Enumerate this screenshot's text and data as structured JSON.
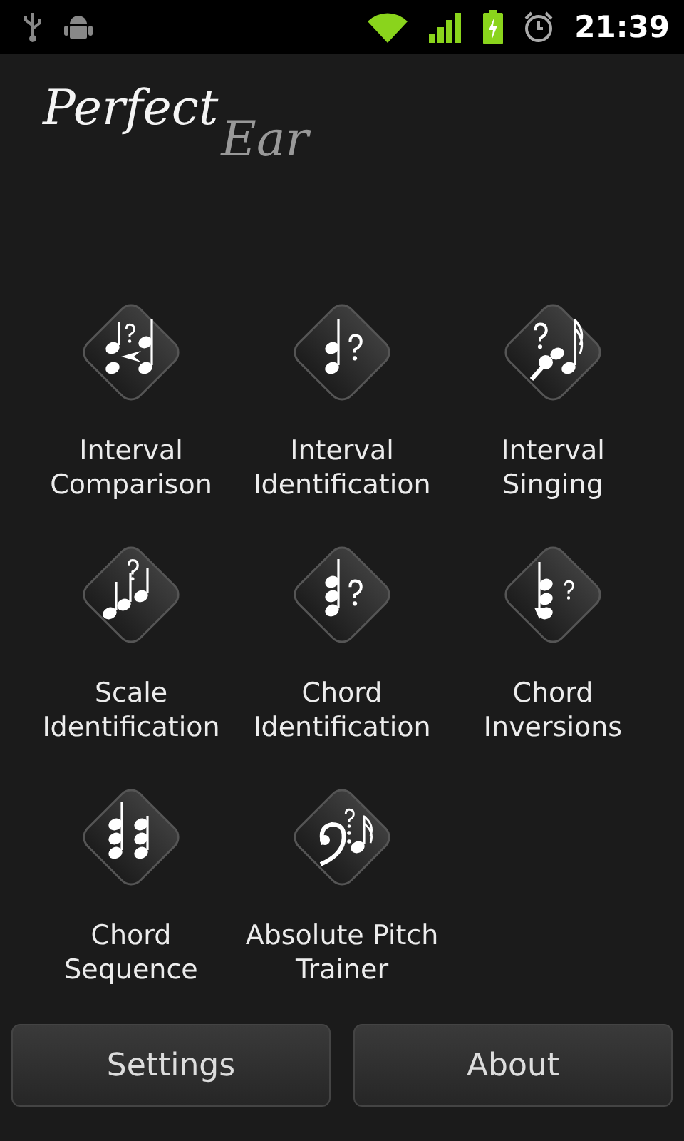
{
  "status_bar": {
    "time": "21:39"
  },
  "logo": {
    "first": "Perfect",
    "second": "Ear"
  },
  "exercises": [
    {
      "label": "Interval Comparison",
      "kind": "comparison"
    },
    {
      "label": "Interval Identification",
      "kind": "interval"
    },
    {
      "label": "Interval Singing",
      "kind": "singing"
    },
    {
      "label": "Scale Identification",
      "kind": "scale"
    },
    {
      "label": "Chord Identification",
      "kind": "chord"
    },
    {
      "label": "Chord Inversions",
      "kind": "inversion"
    },
    {
      "label": "Chord Sequence",
      "kind": "sequence"
    },
    {
      "label": "Absolute Pitch Trainer",
      "kind": "pitch"
    }
  ],
  "buttons": [
    "Settings",
    "About"
  ]
}
